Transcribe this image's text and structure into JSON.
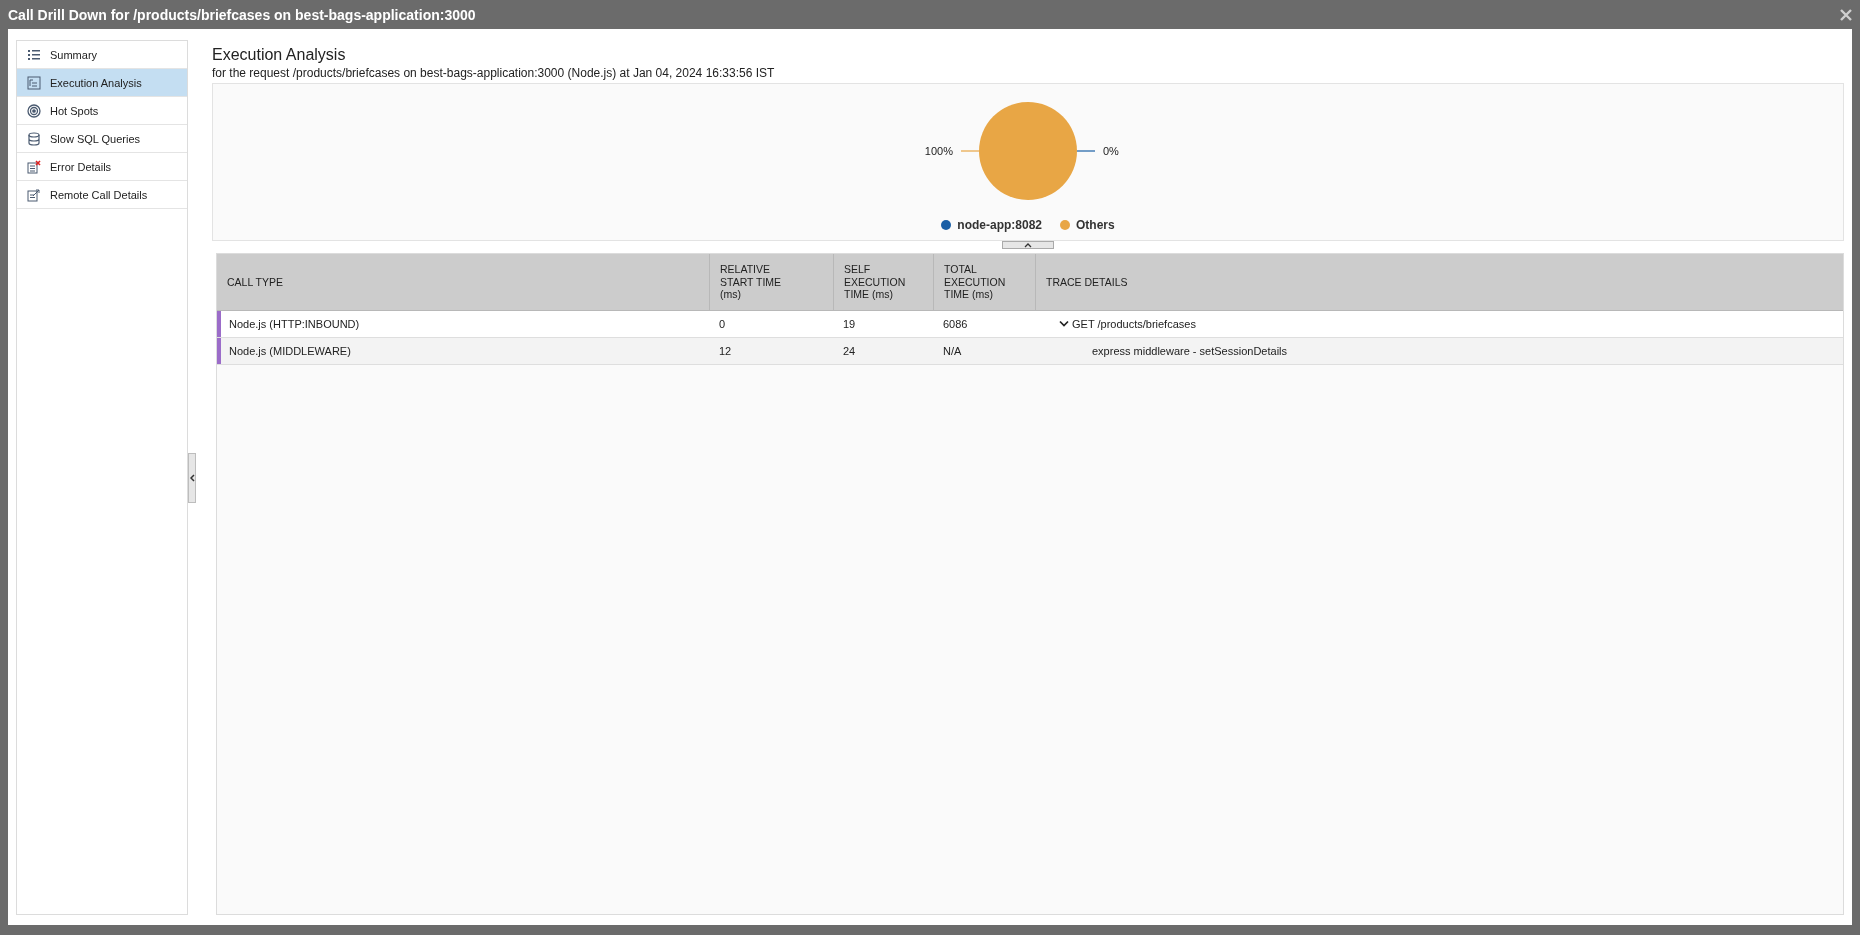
{
  "window": {
    "title": "Call Drill Down for /products/briefcases on best-bags-application:3000"
  },
  "sidebar": {
    "items": [
      {
        "label": "Summary",
        "selected": false
      },
      {
        "label": "Execution Analysis",
        "selected": true
      },
      {
        "label": "Hot Spots",
        "selected": false
      },
      {
        "label": "Slow SQL Queries",
        "selected": false
      },
      {
        "label": "Error Details",
        "selected": false
      },
      {
        "label": "Remote Call Details",
        "selected": false
      }
    ]
  },
  "main": {
    "title": "Execution Analysis",
    "subtitle": "for the request /products/briefcases on best-bags-application:3000 (Node.js) at Jan 04, 2024 16:33:56 IST",
    "chart_data": {
      "type": "pie",
      "categories": [
        "node-app:8082",
        "Others"
      ],
      "values": [
        0,
        100
      ],
      "colors": [
        "#1a5fa6",
        "#e8a645"
      ],
      "value_labels": [
        "0%",
        "100%"
      ]
    }
  },
  "table": {
    "columns": [
      "CALL TYPE",
      "RELATIVE START TIME (ms)",
      "SELF EXECUTION TIME (ms)",
      "TOTAL EXECUTION TIME (ms)",
      "TRACE DETAILS"
    ],
    "rows": [
      {
        "call_type": "Node.js (HTTP:INBOUND)",
        "color": "#9b6cc9",
        "relative_start": "0",
        "self_time": "19",
        "total_time": "6086",
        "trace": "GET /products/briefcases",
        "expanded": true,
        "children": [
          {
            "call_type": "Node.js (MIDDLEWARE)",
            "color": "#9b6cc9",
            "relative_start": "12",
            "self_time": "24",
            "total_time": "N/A",
            "trace": "express middleware - setSessionDetails"
          }
        ]
      }
    ]
  }
}
